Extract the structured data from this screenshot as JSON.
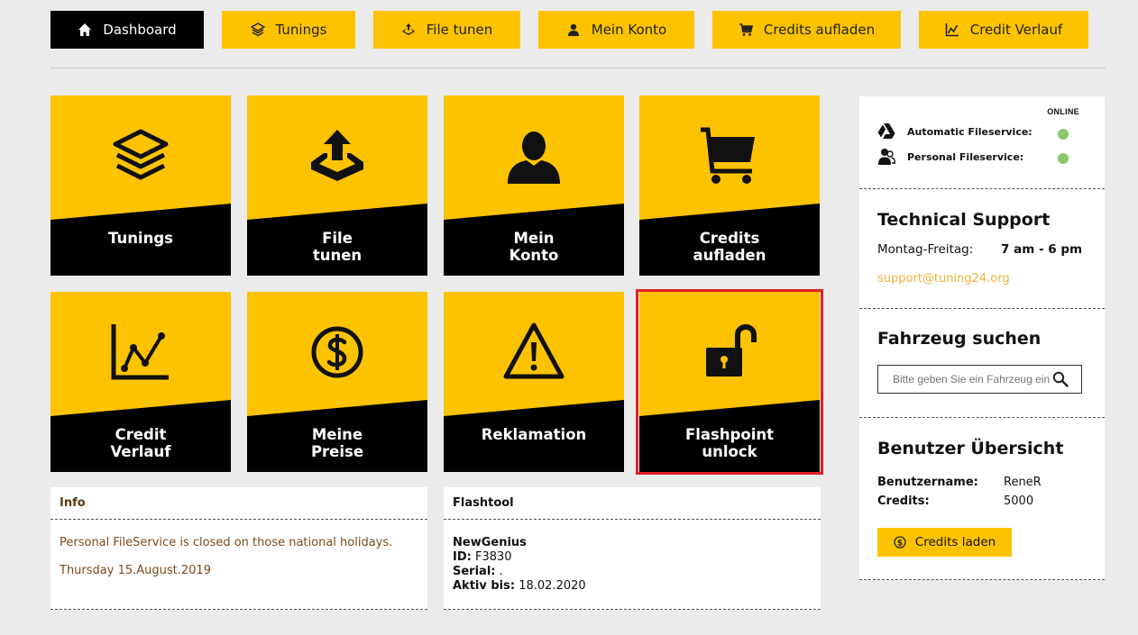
{
  "nav": [
    {
      "label": "Dashboard",
      "icon": "home-icon"
    },
    {
      "label": "Tunings",
      "icon": "layers-icon"
    },
    {
      "label": "File tunen",
      "icon": "upload-icon"
    },
    {
      "label": "Mein Konto",
      "icon": "user-icon"
    },
    {
      "label": "Credits aufladen",
      "icon": "cart-icon"
    },
    {
      "label": "Credit Verlauf",
      "icon": "chart-icon"
    }
  ],
  "tiles": [
    {
      "l1": "Tunings",
      "l2": "",
      "icon": "layers-icon"
    },
    {
      "l1": "File",
      "l2": "tunen",
      "icon": "upload-icon"
    },
    {
      "l1": "Mein",
      "l2": "Konto",
      "icon": "user-icon"
    },
    {
      "l1": "Credits",
      "l2": "aufladen",
      "icon": "cart-icon"
    },
    {
      "l1": "Credit",
      "l2": "Verlauf",
      "icon": "chart-icon"
    },
    {
      "l1": "Meine",
      "l2": "Preise",
      "icon": "dollar-icon"
    },
    {
      "l1": "Reklamation",
      "l2": "",
      "icon": "warning-icon"
    },
    {
      "l1": "Flashpoint",
      "l2": "unlock",
      "icon": "unlock-icon"
    }
  ],
  "info": {
    "title": "Info",
    "line1": "Personal FileService is closed on those national holidays.",
    "line2": "Thursday 15.August.2019"
  },
  "flashtool": {
    "title": "Flashtool",
    "name": "NewGenius",
    "id_label": "ID:",
    "id_value": "F3830",
    "serial_label": "Serial:",
    "serial_value": ".",
    "aktiv_label": "Aktiv bis:",
    "aktiv_value": "18.02.2020"
  },
  "status": {
    "header": "ONLINE",
    "automatic": "Automatic Fileservice:",
    "personal": "Personal Fileservice:",
    "online_color": "#8cc56b"
  },
  "support": {
    "title": "Technical Support",
    "days": "Montag-Freitag:",
    "hours": "7 am - 6 pm",
    "email": "support@tuning24.org"
  },
  "vehicle_search": {
    "title": "Fahrzeug suchen",
    "placeholder": "Bitte geben Sie ein Fahrzeug ein"
  },
  "user": {
    "title": "Benutzer Übersicht",
    "username_label": "Benutzername:",
    "username": "ReneR",
    "credits_label": "Credits:",
    "credits": "5000",
    "button": "Credits laden"
  },
  "colors": {
    "accent": "#fdc300",
    "highlight": "#e2202c"
  }
}
